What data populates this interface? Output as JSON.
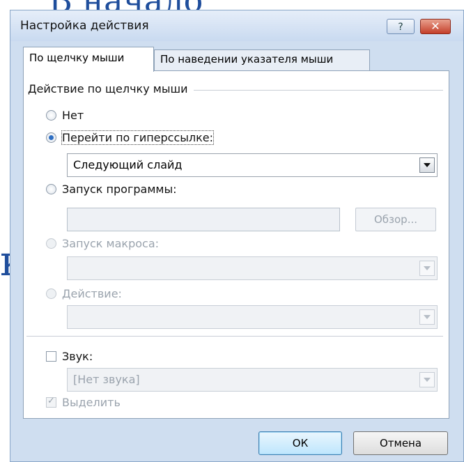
{
  "background": {
    "title_fragment": "В начало",
    "side_fragment": "к"
  },
  "dialog": {
    "title": "Настройка действия",
    "help_label": "?",
    "close_label": "✕"
  },
  "tabs": [
    {
      "label": "По щелчку мыши",
      "active": true
    },
    {
      "label": "По наведении указателя мыши",
      "active": false
    }
  ],
  "section": {
    "label": "Действие по щелчку мыши"
  },
  "options": {
    "none": {
      "label": "Нет",
      "selected": false
    },
    "hyperlink": {
      "label": "Перейти по гиперссылке:",
      "selected": true,
      "value": "Следующий слайд"
    },
    "run_program": {
      "label": "Запуск программы:",
      "selected": false,
      "input_value": "",
      "browse_label": "Обзор..."
    },
    "run_macro": {
      "label": "Запуск макроса:",
      "selected": false,
      "enabled": false,
      "value": ""
    },
    "action": {
      "label": "Действие:",
      "selected": false,
      "enabled": false,
      "value": ""
    }
  },
  "sound": {
    "label": "Звук:",
    "checked": false,
    "value": "[Нет звука]"
  },
  "highlight": {
    "label": "Выделить",
    "checked": true,
    "enabled": false
  },
  "buttons": {
    "ok": "ОК",
    "cancel": "Отмена"
  },
  "colors": {
    "accent": "#2f6fc3",
    "close": "#c4402a",
    "background_text": "#1f4e9c"
  }
}
